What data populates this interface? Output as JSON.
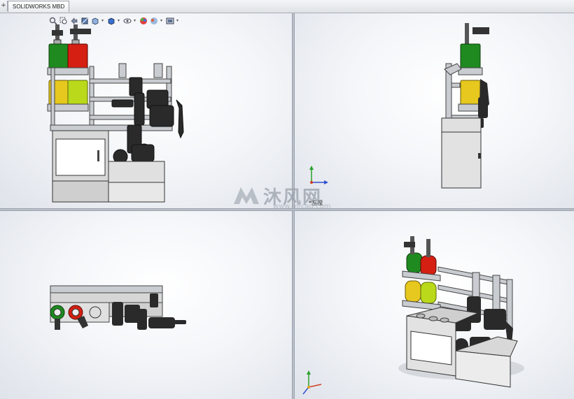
{
  "tabs": {
    "control": "+",
    "active": "SOLIDWORKS MBD"
  },
  "toolbar": {
    "icons": [
      "zoom-fit-icon",
      "zoom-area-icon",
      "previous-view-icon",
      "section-view-icon",
      "view-orientation-icon",
      "display-style-icon",
      "hide-show-icon",
      "appearance-icon",
      "scene-icon",
      "view-settings-icon"
    ]
  },
  "viewports": {
    "front": {
      "name": "front"
    },
    "left": {
      "name": "left",
      "label": "*左视"
    },
    "top": {
      "name": "top"
    },
    "iso": {
      "name": "isometric"
    }
  },
  "watermark": {
    "brand": "沐风网",
    "url": "www.mfcad.com"
  },
  "colors": {
    "green": "#1f8a1f",
    "red": "#d41f12",
    "yellow": "#e6c81e",
    "lime": "#b9d91a",
    "frame": "#c9ccd0",
    "dark": "#2a2a2a",
    "cabinet": "#e0e0e0",
    "axis_y": "#2aa02a",
    "axis_x": "#d04020",
    "axis_z": "#3050d0"
  }
}
